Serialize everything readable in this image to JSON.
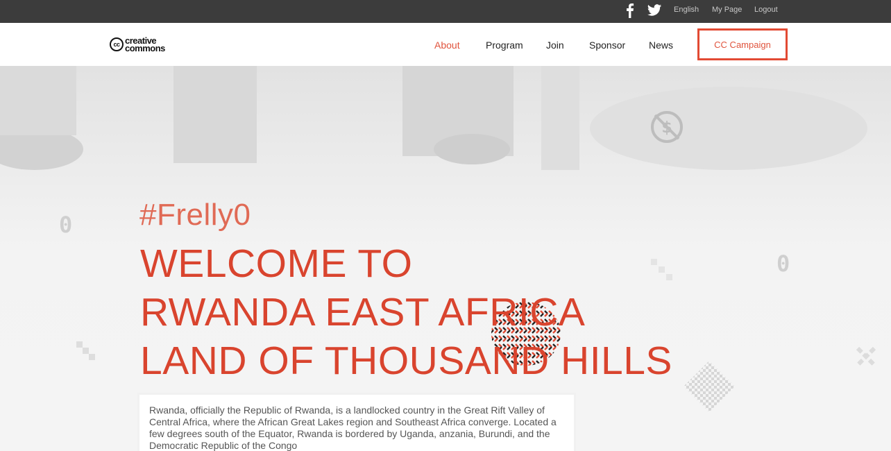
{
  "topbar": {
    "icons": [
      "facebook-icon",
      "twitter-icon"
    ],
    "links": [
      "English",
      "My Page",
      "Logout"
    ]
  },
  "nav": {
    "logo": {
      "badge": "cc",
      "line1": "creative",
      "line2": "commons"
    },
    "items": [
      "About",
      "Program",
      "Join",
      "Sponsor",
      "News"
    ],
    "active": "About",
    "campaign": "CC Campaign"
  },
  "hero": {
    "hashtag": "#Frelly0",
    "headline": [
      "WELCOME TO",
      "RWANDA EAST AFRICA",
      "LAND OF THOUSAND HILLS"
    ],
    "description": "Rwanda, officially the Republic of Rwanda, is a landlocked country in the Great Rift Valley of Central Africa, where the African Great Lakes region and Southeast Africa converge. Located a few degrees south of the Equator, Rwanda is bordered by Uganda, anzania, Burundi, and the Democratic Republic of the Congo",
    "decor_glyphs": [
      "0",
      "0"
    ]
  },
  "colors": {
    "accent": "#e24a33",
    "topbar": "#3c3c3c",
    "text": "#555555"
  }
}
